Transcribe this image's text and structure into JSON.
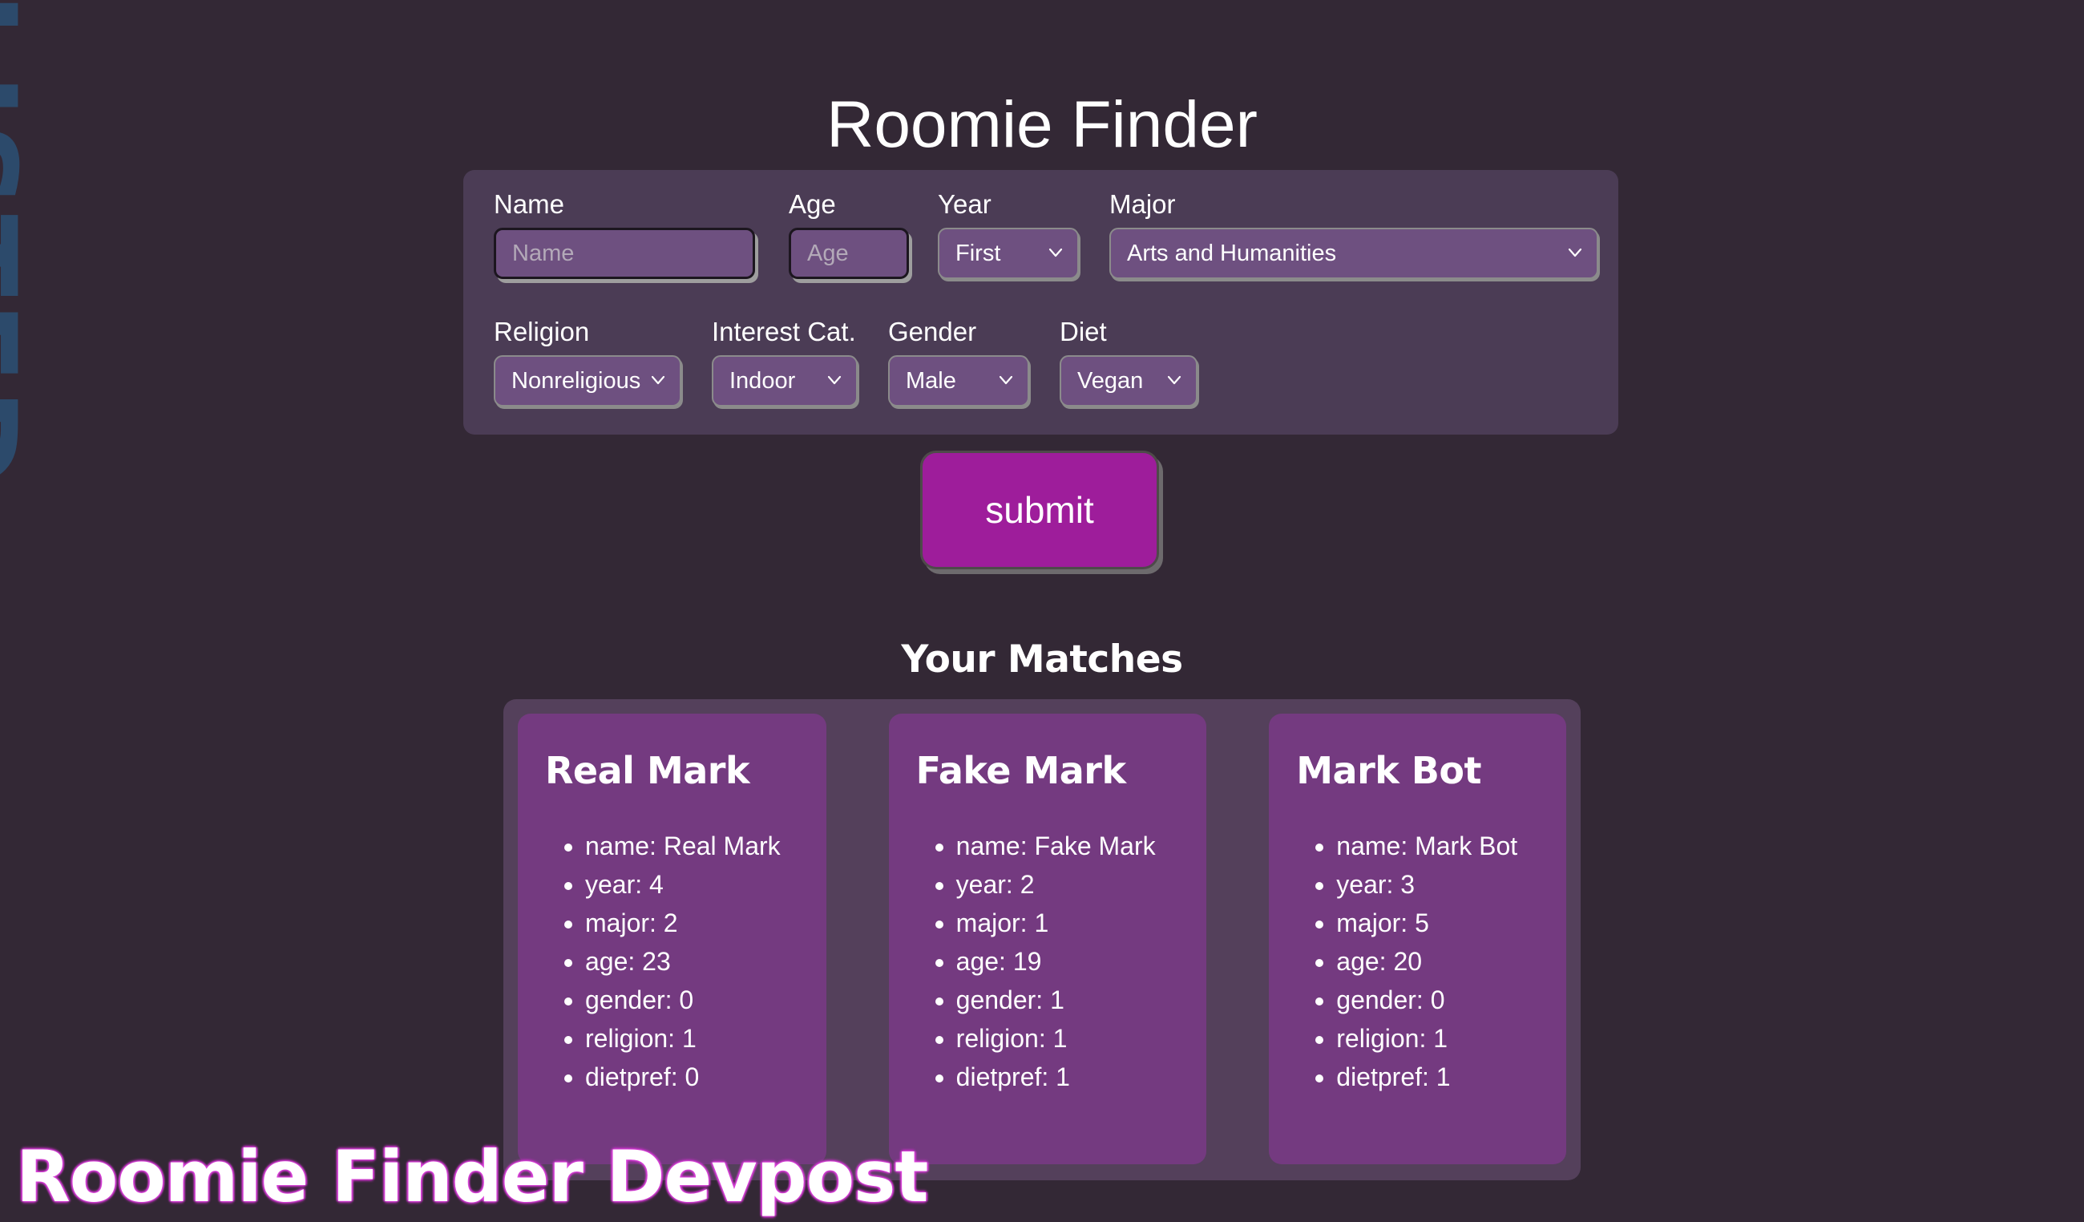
{
  "page": {
    "title": "Roomie Finder",
    "background_color": "#332835",
    "edge_watermark_text": "LISTED",
    "edge_watermark_color": "#2c4a6b"
  },
  "form": {
    "panel_color": "#4b3c55",
    "field_color": "#6e5080",
    "row1": [
      {
        "label": "Name",
        "type": "text",
        "value": "",
        "placeholder": "Name"
      },
      {
        "label": "Age",
        "type": "text",
        "value": "",
        "placeholder": "Age"
      },
      {
        "label": "Year",
        "type": "select",
        "value": "First"
      },
      {
        "label": "Major",
        "type": "select",
        "value": "Arts and Humanities"
      }
    ],
    "row2": [
      {
        "label": "Religion",
        "type": "select",
        "value": "Nonreligious"
      },
      {
        "label": "Interest Cat.",
        "type": "select",
        "value": "Indoor"
      },
      {
        "label": "Gender",
        "type": "select",
        "value": "Male"
      },
      {
        "label": "Diet",
        "type": "select",
        "value": "Vegan"
      }
    ]
  },
  "submit": {
    "label": "submit",
    "color": "#9e1d9b"
  },
  "matches": {
    "heading": "Your Matches",
    "container_color": "#54405b",
    "card_color": "#743a80",
    "cards": [
      {
        "title": "Real Mark",
        "details": [
          "name: Real Mark",
          "year: 4",
          "major: 2",
          "age: 23",
          "gender: 0",
          "religion: 1",
          "dietpref: 0"
        ]
      },
      {
        "title": "Fake Mark",
        "details": [
          "name: Fake Mark",
          "year: 2",
          "major: 1",
          "age: 19",
          "gender: 1",
          "religion: 1",
          "dietpref: 1"
        ]
      },
      {
        "title": "Mark Bot",
        "details": [
          "name: Mark Bot",
          "year: 3",
          "major: 5",
          "age: 20",
          "gender: 0",
          "religion: 1",
          "dietpref: 1"
        ]
      }
    ]
  },
  "overlay": {
    "devpost_text": "Roomie Finder Devpost",
    "glow_color": "#d93fd9"
  },
  "icons": {
    "chevron_down": "chevron-down-icon"
  }
}
